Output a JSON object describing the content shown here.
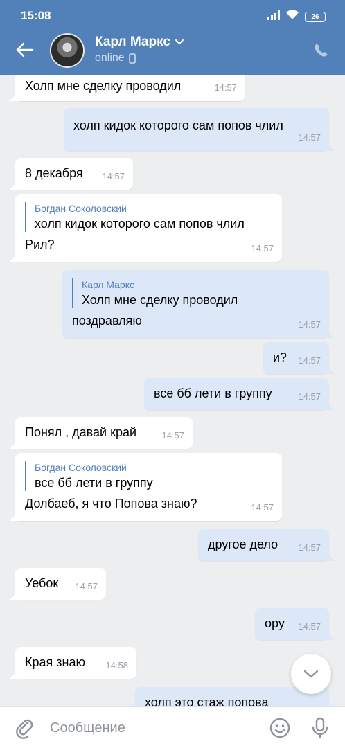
{
  "status_bar": {
    "time": "15:08",
    "battery": "26"
  },
  "header": {
    "name": "Карл Маркс",
    "status": "online"
  },
  "messages": [
    {
      "type": "in",
      "text": "Холп мне сделку проводил",
      "time": "14:57"
    },
    {
      "type": "out",
      "text": "холп кидок которого сам попов члил",
      "time": "14:57"
    },
    {
      "type": "in",
      "text": "8 декабря",
      "time": "14:57"
    },
    {
      "type": "in",
      "reply_author": "Богдан Соколовский",
      "reply_text": "холп кидок которого сам попов члил",
      "text": "Рил?",
      "time": "14:57"
    },
    {
      "type": "out",
      "reply_author": "Карл Маркс",
      "reply_text": "Холп мне сделку проводил",
      "text": "поздравляю",
      "time": "14:57"
    },
    {
      "type": "out",
      "text": "и?",
      "time": "14:57"
    },
    {
      "type": "out",
      "text": "все бб лети в группу",
      "time": "14:57"
    },
    {
      "type": "in",
      "text": "Понял , давай край",
      "time": "14:57"
    },
    {
      "type": "in",
      "reply_author": "Богдан Соколовский",
      "reply_text": "все бб лети в группу",
      "text": "Долбаеб, я что Попова знаю?",
      "time": "14:57"
    },
    {
      "type": "out",
      "text": "другое дело",
      "time": "14:57"
    },
    {
      "type": "in",
      "text": "Уебок",
      "time": "14:57"
    },
    {
      "type": "out",
      "text": "ору",
      "time": "14:57"
    },
    {
      "type": "in",
      "text": "Края знаю",
      "time": "14:58"
    },
    {
      "type": "out",
      "text": "холп это стаж попова",
      "time": ""
    }
  ],
  "input": {
    "placeholder": "Сообщение"
  },
  "icons": {
    "back": "arrow-left-icon",
    "call": "phone-icon",
    "attach": "paperclip-icon",
    "emoji": "smile-icon",
    "mic": "microphone-icon",
    "scroll": "chevron-down-icon",
    "mobile": "mobile-icon",
    "dropdown": "chevron-down-icon"
  },
  "colors": {
    "header": "#5181b8",
    "background": "#edeef0",
    "outgoing": "#dce8f8",
    "incoming": "#ffffff",
    "accent": "#5181b8"
  }
}
